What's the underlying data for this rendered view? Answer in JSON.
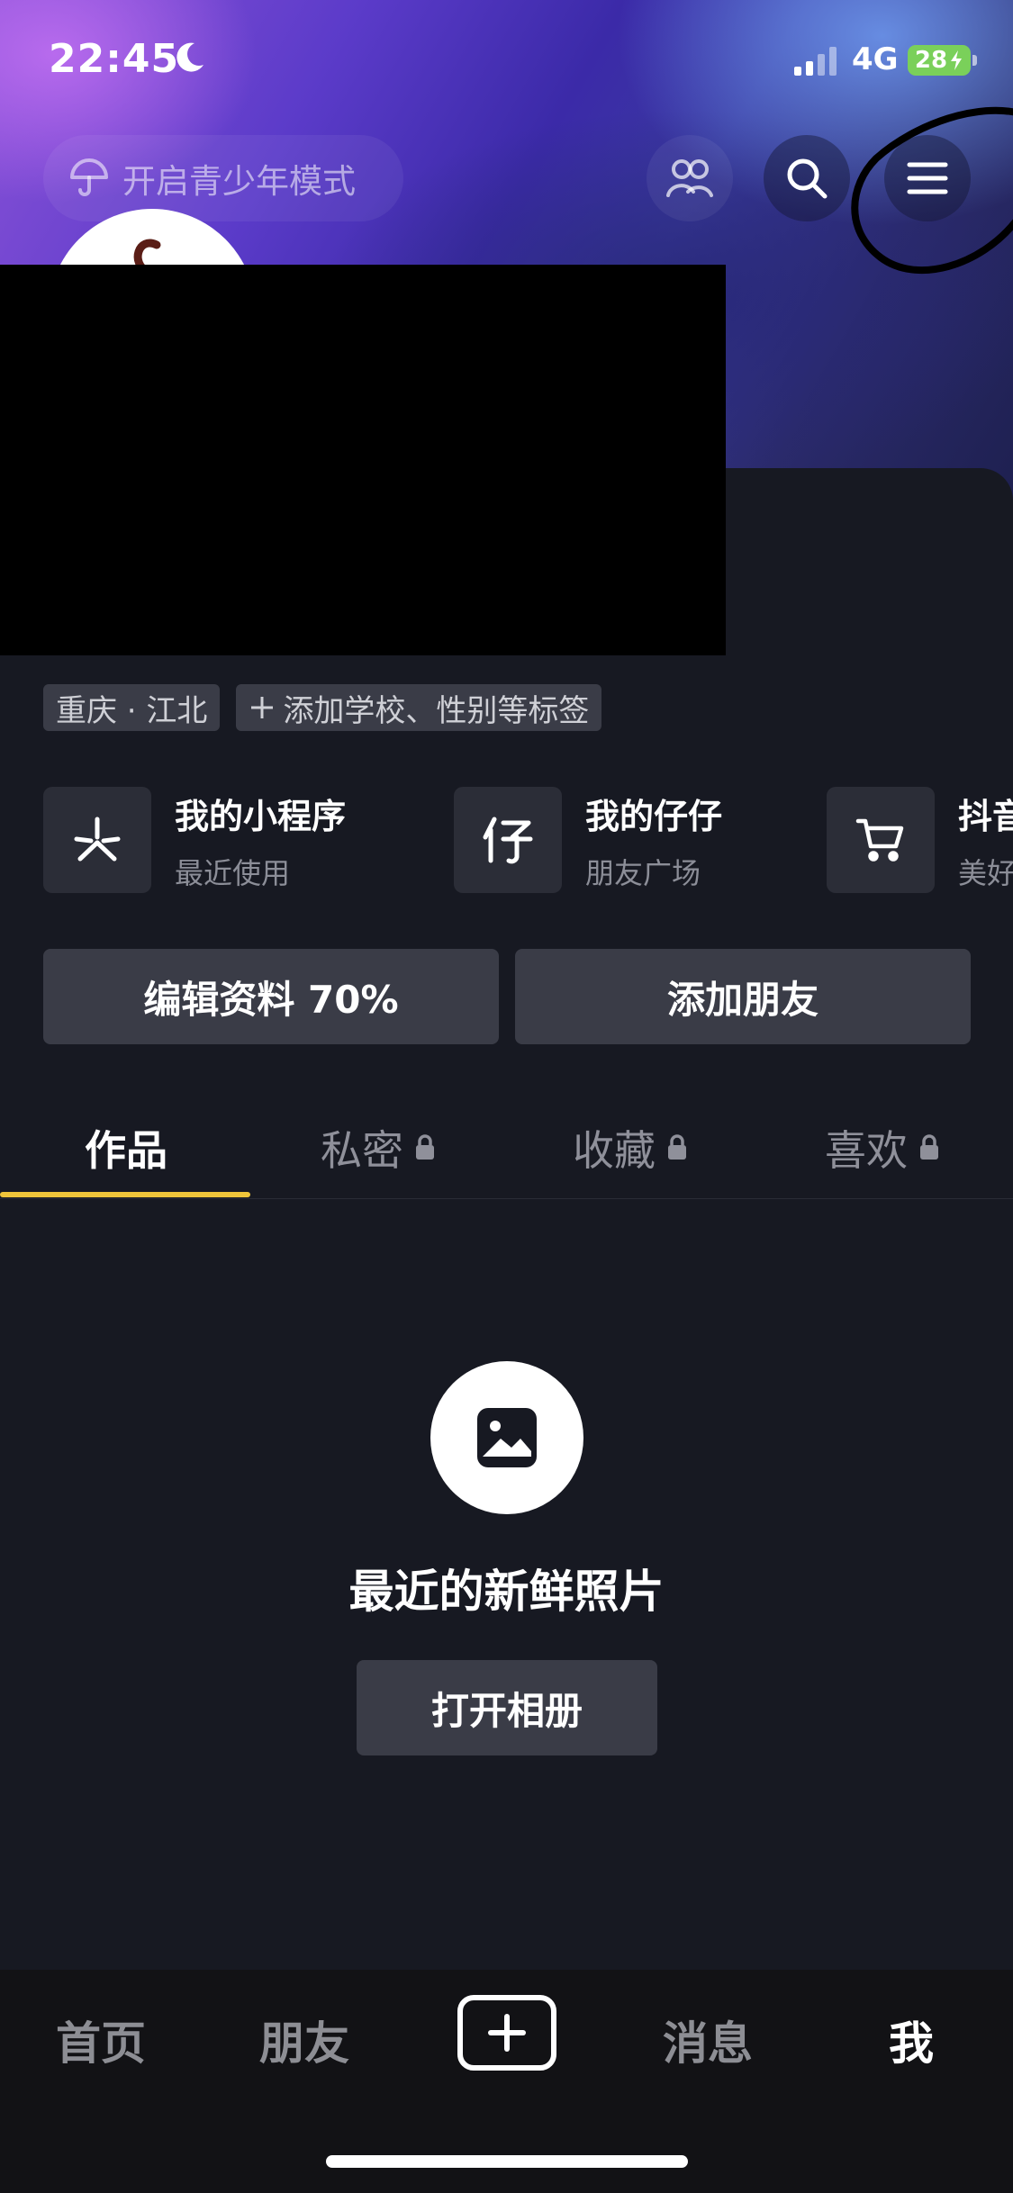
{
  "status_bar": {
    "time": "22:45",
    "network": "4G",
    "battery": "28"
  },
  "header": {
    "teen_mode_label": "开启青少年模式",
    "icons": [
      "umbrella-icon",
      "friends-icon",
      "search-icon",
      "menu-icon"
    ]
  },
  "profile": {
    "tags": {
      "location": "重庆 · 江北",
      "add_tags": "添加学校、性别等标签"
    }
  },
  "shortcuts": [
    {
      "title": "我的小程序",
      "subtitle": "最近使用",
      "icon": "mini-program-icon"
    },
    {
      "title": "我的仔仔",
      "subtitle": "朋友广场",
      "icon": "zaizai-icon"
    },
    {
      "title": "抖音",
      "subtitle": "美好",
      "icon": "cart-icon"
    }
  ],
  "actions": {
    "edit_profile": "编辑资料 70%",
    "add_friends": "添加朋友"
  },
  "tabs": [
    {
      "label": "作品",
      "active": true,
      "locked": false
    },
    {
      "label": "私密",
      "active": false,
      "locked": true
    },
    {
      "label": "收藏",
      "active": false,
      "locked": true
    },
    {
      "label": "喜欢",
      "active": false,
      "locked": true
    }
  ],
  "empty_state": {
    "title": "最近的新鲜照片",
    "button": "打开相册",
    "icon": "image-icon"
  },
  "bottom_nav": {
    "home": "首页",
    "friends": "朋友",
    "messages": "消息",
    "me": "我",
    "active": "我"
  },
  "colors": {
    "background": "#171922",
    "accent_underline": "#f0c53a",
    "battery": "#7ad05a",
    "button_bg": "#3a3c47"
  }
}
